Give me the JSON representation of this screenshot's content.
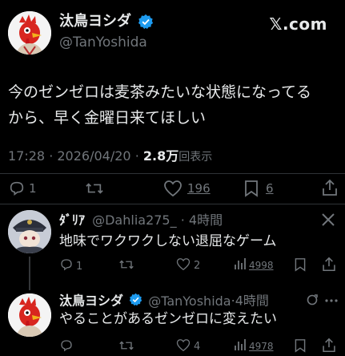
{
  "header": {
    "display_name": "汰鳥ヨシダ",
    "handle": "@TanYoshida",
    "watermark": "𝕏.com"
  },
  "tweet": {
    "line1": "今のゼンゼロは麦茶みたいな状態になってる",
    "line2": "から、早く金曜日来てほしい",
    "time": "17:28",
    "date": "2026/04/20",
    "views_value": "2.8万",
    "views_label": "回表示",
    "replies": "1",
    "likes": "196",
    "bookmarks": "6"
  },
  "reply1": {
    "display_name": "ﾀﾞﾘｱ",
    "handle": "@Dahlia275_",
    "time": "4時間",
    "text": "地味でワクワクしない退屈なゲーム",
    "replies": "1",
    "likes": "2",
    "views": "4998"
  },
  "reply2": {
    "display_name": "汰鳥ヨシダ",
    "handle": "@TanYoshida",
    "time": "4時間",
    "text": "やることがあるゼンゼロに変えたい",
    "likes": "4",
    "views": "4978"
  },
  "icons": {
    "verified": "verified-badge-icon",
    "reply": "reply-icon",
    "retweet": "retweet-icon",
    "like": "heart-icon",
    "bookmark": "bookmark-icon",
    "share": "share-icon",
    "views": "views-chart-icon"
  },
  "colors": {
    "background": "#000000",
    "text": "#e7e9ea",
    "muted": "#71767b",
    "verified": "#1d9bf0",
    "divider": "#2f3336"
  }
}
